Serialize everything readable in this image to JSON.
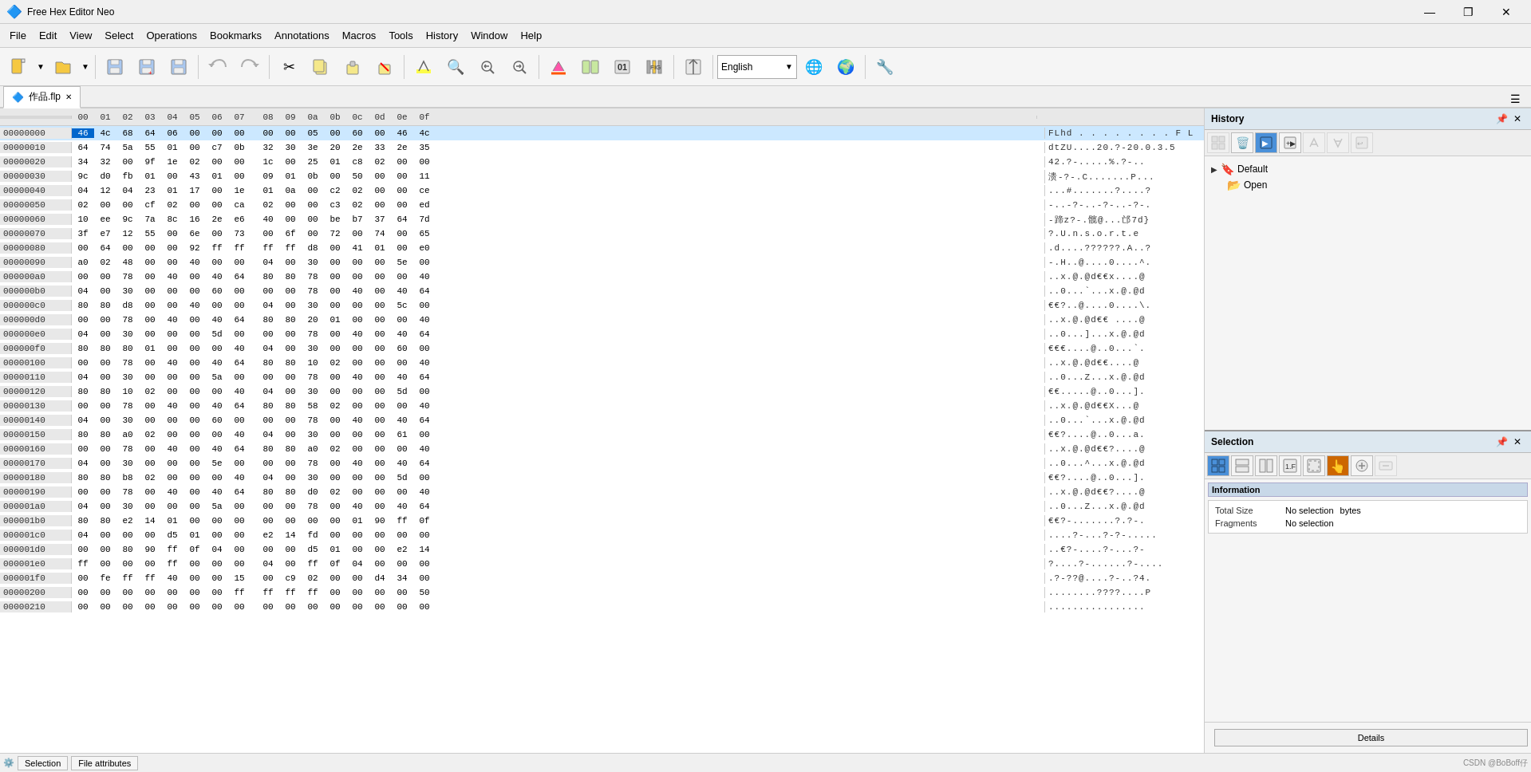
{
  "app": {
    "title": "Free Hex Editor Neo",
    "icon": "🔷"
  },
  "titlebar": {
    "minimize": "—",
    "maximize": "❐",
    "close": "✕"
  },
  "menubar": {
    "items": [
      "File",
      "Edit",
      "View",
      "Select",
      "Operations",
      "Bookmarks",
      "Annotations",
      "Macros",
      "Tools",
      "History",
      "Window",
      "Help"
    ]
  },
  "toolbar": {
    "language": "English"
  },
  "tab": {
    "name": "作品.flp",
    "close": "✕"
  },
  "hex_editor": {
    "columns": [
      "00",
      "01",
      "02",
      "03",
      "04",
      "05",
      "06",
      "07",
      "08",
      "09",
      "0a",
      "0b",
      "0c",
      "0d",
      "0e",
      "0f"
    ],
    "rows": [
      {
        "offset": "00000000",
        "bytes": [
          "46",
          "4c",
          "68",
          "64",
          "06",
          "00",
          "00",
          "00",
          "00",
          "00",
          "05",
          "00",
          "60",
          "00",
          "46",
          "4c"
        ],
        "ascii": "FLhd . . . . . . . . F L"
      },
      {
        "offset": "00000010",
        "bytes": [
          "64",
          "74",
          "5a",
          "55",
          "01",
          "00",
          "c7",
          "0b",
          "32",
          "30",
          "3e",
          "20",
          "2e",
          "33",
          "2e",
          "35"
        ],
        "ascii": "dtZU....20.?-20.0.3.5"
      },
      {
        "offset": "00000020",
        "bytes": [
          "34",
          "32",
          "00",
          "9f",
          "1e",
          "02",
          "00",
          "00",
          "1c",
          "00",
          "25",
          "01",
          "c8",
          "02",
          "00",
          "00"
        ],
        "ascii": "42.?-.....%.?-.."
      },
      {
        "offset": "00000030",
        "bytes": [
          "9c",
          "d0",
          "fb",
          "01",
          "00",
          "43",
          "01",
          "00",
          "09",
          "01",
          "0b",
          "00",
          "50",
          "00",
          "00",
          "11"
        ],
        "ascii": "溃-?-.C.......P..."
      },
      {
        "offset": "00000040",
        "bytes": [
          "04",
          "12",
          "04",
          "23",
          "01",
          "17",
          "00",
          "1e",
          "01",
          "0a",
          "00",
          "c2",
          "02",
          "00",
          "00",
          "ce"
        ],
        "ascii": "...#.......?....?"
      },
      {
        "offset": "00000050",
        "bytes": [
          "02",
          "00",
          "00",
          "cf",
          "02",
          "00",
          "00",
          "ca",
          "02",
          "00",
          "00",
          "c3",
          "02",
          "00",
          "00",
          "ed"
        ],
        "ascii": "-..-?-..-?-..-?-."
      },
      {
        "offset": "00000060",
        "bytes": [
          "10",
          "ee",
          "9c",
          "7a",
          "8c",
          "16",
          "2e",
          "e6",
          "40",
          "00",
          "00",
          "be",
          "b7",
          "37",
          "64",
          "7d"
        ],
        "ascii": "-蹄z?-.髋@...邙7d}"
      },
      {
        "offset": "00000070",
        "bytes": [
          "3f",
          "e7",
          "12",
          "55",
          "00",
          "6e",
          "00",
          "73",
          "00",
          "6f",
          "00",
          "72",
          "00",
          "74",
          "00",
          "65"
        ],
        "ascii": "?.U.n.s.o.r.t.e"
      },
      {
        "offset": "00000080",
        "bytes": [
          "00",
          "64",
          "00",
          "00",
          "00",
          "92",
          "ff",
          "ff",
          "ff",
          "ff",
          "d8",
          "00",
          "41",
          "01",
          "00",
          "e0"
        ],
        "ascii": ".d....??????.A..?"
      },
      {
        "offset": "00000090",
        "bytes": [
          "a0",
          "02",
          "48",
          "00",
          "00",
          "40",
          "00",
          "00",
          "04",
          "00",
          "30",
          "00",
          "00",
          "00",
          "5e",
          "00"
        ],
        "ascii": "-.H..@....0....^."
      },
      {
        "offset": "000000a0",
        "bytes": [
          "00",
          "00",
          "78",
          "00",
          "40",
          "00",
          "40",
          "64",
          "80",
          "80",
          "78",
          "00",
          "00",
          "00",
          "00",
          "40"
        ],
        "ascii": "..x.@.@d€€x....@"
      },
      {
        "offset": "000000b0",
        "bytes": [
          "04",
          "00",
          "30",
          "00",
          "00",
          "00",
          "60",
          "00",
          "00",
          "00",
          "78",
          "00",
          "40",
          "00",
          "40",
          "64"
        ],
        "ascii": "..0...`...x.@.@d"
      },
      {
        "offset": "000000c0",
        "bytes": [
          "80",
          "80",
          "d8",
          "00",
          "00",
          "40",
          "00",
          "00",
          "04",
          "00",
          "30",
          "00",
          "00",
          "00",
          "5c",
          "00"
        ],
        "ascii": "€€?..@....0....\\."
      },
      {
        "offset": "000000d0",
        "bytes": [
          "00",
          "00",
          "78",
          "00",
          "40",
          "00",
          "40",
          "64",
          "80",
          "80",
          "20",
          "01",
          "00",
          "00",
          "00",
          "40"
        ],
        "ascii": "..x.@.@d€€ ....@"
      },
      {
        "offset": "000000e0",
        "bytes": [
          "04",
          "00",
          "30",
          "00",
          "00",
          "00",
          "5d",
          "00",
          "00",
          "00",
          "78",
          "00",
          "40",
          "00",
          "40",
          "64"
        ],
        "ascii": "..0...]...x.@.@d"
      },
      {
        "offset": "000000f0",
        "bytes": [
          "80",
          "80",
          "80",
          "01",
          "00",
          "00",
          "00",
          "40",
          "04",
          "00",
          "30",
          "00",
          "00",
          "00",
          "60",
          "00"
        ],
        "ascii": "€€€....@..0...`."
      },
      {
        "offset": "00000100",
        "bytes": [
          "00",
          "00",
          "78",
          "00",
          "40",
          "00",
          "40",
          "64",
          "80",
          "80",
          "10",
          "02",
          "00",
          "00",
          "00",
          "40"
        ],
        "ascii": "..x.@.@d€€....@"
      },
      {
        "offset": "00000110",
        "bytes": [
          "04",
          "00",
          "30",
          "00",
          "00",
          "00",
          "5a",
          "00",
          "00",
          "00",
          "78",
          "00",
          "40",
          "00",
          "40",
          "64"
        ],
        "ascii": "..0...Z...x.@.@d"
      },
      {
        "offset": "00000120",
        "bytes": [
          "80",
          "80",
          "10",
          "02",
          "00",
          "00",
          "00",
          "40",
          "04",
          "00",
          "30",
          "00",
          "00",
          "00",
          "5d",
          "00"
        ],
        "ascii": "€€.....@..0...]."
      },
      {
        "offset": "00000130",
        "bytes": [
          "00",
          "00",
          "78",
          "00",
          "40",
          "00",
          "40",
          "64",
          "80",
          "80",
          "58",
          "02",
          "00",
          "00",
          "00",
          "40"
        ],
        "ascii": "..x.@.@d€€X...@"
      },
      {
        "offset": "00000140",
        "bytes": [
          "04",
          "00",
          "30",
          "00",
          "00",
          "00",
          "60",
          "00",
          "00",
          "00",
          "78",
          "00",
          "40",
          "00",
          "40",
          "64"
        ],
        "ascii": "..0...`...x.@.@d"
      },
      {
        "offset": "00000150",
        "bytes": [
          "80",
          "80",
          "a0",
          "02",
          "00",
          "00",
          "00",
          "40",
          "04",
          "00",
          "30",
          "00",
          "00",
          "00",
          "61",
          "00"
        ],
        "ascii": "€€?....@..0...a."
      },
      {
        "offset": "00000160",
        "bytes": [
          "00",
          "00",
          "78",
          "00",
          "40",
          "00",
          "40",
          "64",
          "80",
          "80",
          "a0",
          "02",
          "00",
          "00",
          "00",
          "40"
        ],
        "ascii": "..x.@.@d€€?....@"
      },
      {
        "offset": "00000170",
        "bytes": [
          "04",
          "00",
          "30",
          "00",
          "00",
          "00",
          "5e",
          "00",
          "00",
          "00",
          "78",
          "00",
          "40",
          "00",
          "40",
          "64"
        ],
        "ascii": "..0...^...x.@.@d"
      },
      {
        "offset": "00000180",
        "bytes": [
          "80",
          "80",
          "b8",
          "02",
          "00",
          "00",
          "00",
          "40",
          "04",
          "00",
          "30",
          "00",
          "00",
          "00",
          "5d",
          "00"
        ],
        "ascii": "€€?....@..0...]."
      },
      {
        "offset": "00000190",
        "bytes": [
          "00",
          "00",
          "78",
          "00",
          "40",
          "00",
          "40",
          "64",
          "80",
          "80",
          "d0",
          "02",
          "00",
          "00",
          "00",
          "40"
        ],
        "ascii": "..x.@.@d€€?....@"
      },
      {
        "offset": "000001a0",
        "bytes": [
          "04",
          "00",
          "30",
          "00",
          "00",
          "00",
          "5a",
          "00",
          "00",
          "00",
          "78",
          "00",
          "40",
          "00",
          "40",
          "64"
        ],
        "ascii": "..0...Z...x.@.@d"
      },
      {
        "offset": "000001b0",
        "bytes": [
          "80",
          "80",
          "e2",
          "14",
          "01",
          "00",
          "00",
          "00",
          "00",
          "00",
          "00",
          "00",
          "01",
          "90",
          "ff",
          "0f"
        ],
        "ascii": "€€?-.......?.?-."
      },
      {
        "offset": "000001c0",
        "bytes": [
          "04",
          "00",
          "00",
          "00",
          "d5",
          "01",
          "00",
          "00",
          "e2",
          "14",
          "fd",
          "00",
          "00",
          "00",
          "00",
          "00"
        ],
        "ascii": "....?-...?-?-....."
      },
      {
        "offset": "000001d0",
        "bytes": [
          "00",
          "00",
          "80",
          "90",
          "ff",
          "0f",
          "04",
          "00",
          "00",
          "00",
          "d5",
          "01",
          "00",
          "00",
          "e2",
          "14"
        ],
        "ascii": "..€?-....?-...?-"
      },
      {
        "offset": "000001e0",
        "bytes": [
          "ff",
          "00",
          "00",
          "00",
          "ff",
          "00",
          "00",
          "00",
          "04",
          "00",
          "ff",
          "0f",
          "04",
          "00",
          "00",
          "00"
        ],
        "ascii": "?....?-......?-...."
      },
      {
        "offset": "000001f0",
        "bytes": [
          "00",
          "fe",
          "ff",
          "ff",
          "40",
          "00",
          "00",
          "15",
          "00",
          "c9",
          "02",
          "00",
          "00",
          "d4",
          "34",
          "00"
        ],
        "ascii": ".?-??@....?-..?4."
      },
      {
        "offset": "00000200",
        "bytes": [
          "00",
          "00",
          "00",
          "00",
          "00",
          "00",
          "00",
          "ff",
          "ff",
          "ff",
          "ff",
          "00",
          "00",
          "00",
          "00",
          "50"
        ],
        "ascii": "........????....P"
      },
      {
        "offset": "00000210",
        "bytes": [
          "00",
          "00",
          "00",
          "00",
          "00",
          "00",
          "00",
          "00",
          "00",
          "00",
          "00",
          "00",
          "00",
          "00",
          "00",
          "00"
        ],
        "ascii": "................"
      }
    ]
  },
  "history_panel": {
    "title": "History",
    "default_label": "Default",
    "open_label": "Open",
    "folder_icon": "📁",
    "collapse_icon": "▶"
  },
  "selection_panel": {
    "title": "Selection",
    "info": {
      "total_size_label": "Total Size",
      "total_size_value": "No selection",
      "total_size_unit": "bytes",
      "fragments_label": "Fragments",
      "fragments_value": "No selection"
    },
    "information_label": "Information",
    "details_label": "Details"
  },
  "statusbar": {
    "selection_btn": "Selection",
    "file_attributes_btn": "File attributes",
    "credit": "CSDN @BoBoff仔"
  }
}
